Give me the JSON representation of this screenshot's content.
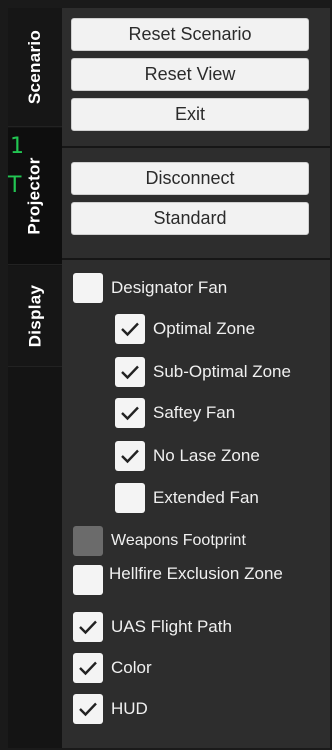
{
  "tabs": {
    "scenario": "Scenario",
    "projector": "Projector",
    "display": "Display"
  },
  "overlay_marks": [
    "1",
    "T"
  ],
  "scenario_panel": {
    "reset_scenario": "Reset Scenario",
    "reset_view": "Reset View",
    "exit": "Exit"
  },
  "projector_panel": {
    "disconnect": "Disconnect",
    "standard": "Standard"
  },
  "display_panel": {
    "items": [
      {
        "label": "Designator Fan",
        "checked": false
      },
      {
        "label": "Optimal Zone",
        "checked": true
      },
      {
        "label": "Sub-Optimal Zone",
        "checked": true
      },
      {
        "label": "Saftey Fan",
        "checked": true
      },
      {
        "label": "No Lase Zone",
        "checked": true
      },
      {
        "label": "Extended Fan",
        "checked": false
      },
      {
        "label": "Weapons Footprint",
        "checked": false,
        "disabled": true
      },
      {
        "label": "Hellfire Exclusion Zone",
        "checked": false
      },
      {
        "label": "UAS Flight Path",
        "checked": true
      },
      {
        "label": "Color",
        "checked": true
      },
      {
        "label": "HUD",
        "checked": true
      }
    ]
  },
  "colors": {
    "panel_bg": "#2d2d2d",
    "button_bg": "#f2f2f2",
    "checkbox_bg": "#f4f4f4",
    "checkbox_disabled": "#6b6b6b",
    "overlay_green": "#22c552"
  }
}
